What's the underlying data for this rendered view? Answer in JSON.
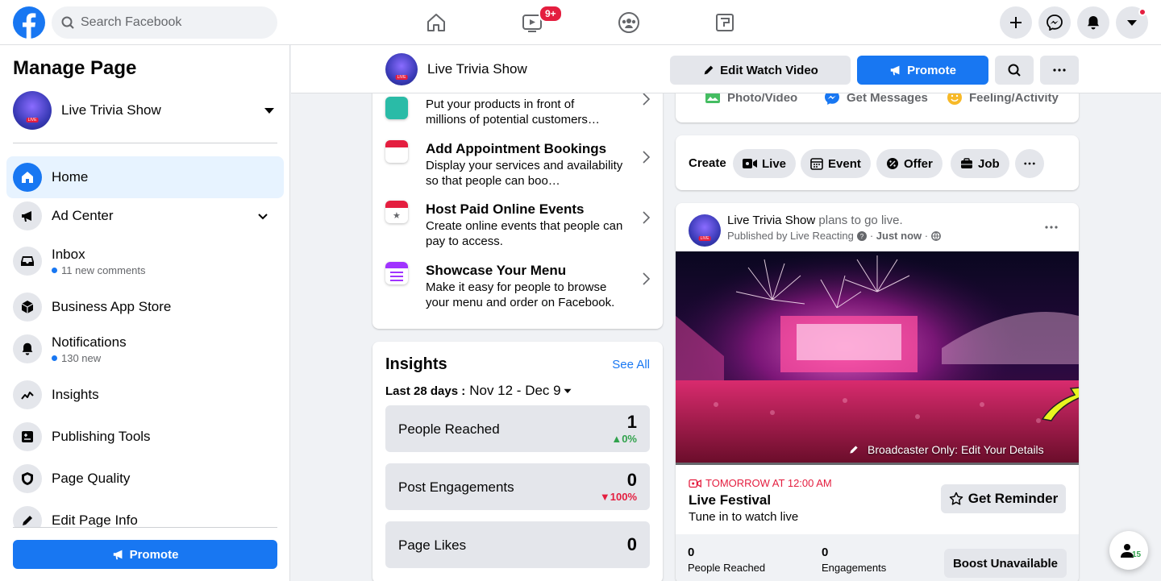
{
  "search": {
    "placeholder": "Search Facebook"
  },
  "topnav": {
    "watch_badge": "9+"
  },
  "sidebar": {
    "title": "Manage Page",
    "page_name": "Live Trivia Show",
    "items": [
      {
        "label": "Home"
      },
      {
        "label": "Ad Center"
      },
      {
        "label": "Inbox",
        "sub": "11 new comments"
      },
      {
        "label": "Business App Store"
      },
      {
        "label": "Notifications",
        "sub": "130 new"
      },
      {
        "label": "Insights"
      },
      {
        "label": "Publishing Tools"
      },
      {
        "label": "Page Quality"
      },
      {
        "label": "Edit Page Info"
      }
    ],
    "promote_label": "Promote"
  },
  "pagebar": {
    "name": "Live Trivia Show",
    "edit_watch_label": "Edit Watch Video",
    "promote_label": "Promote"
  },
  "tips": [
    {
      "title": "",
      "desc": "Put your products in front of millions of potential customers…"
    },
    {
      "title": "Add Appointment Bookings",
      "desc": "Display your services and availability so that people can boo…"
    },
    {
      "title": "Host Paid Online Events",
      "desc": "Create online events that people can pay to access."
    },
    {
      "title": "Showcase Your Menu",
      "desc": "Make it easy for people to browse your menu and order on Facebook."
    }
  ],
  "insights": {
    "title": "Insights",
    "see_all": "See All",
    "range_label": "Last 28 days :",
    "range_value": "Nov 12 - Dec 9",
    "rows": [
      {
        "label": "People Reached",
        "value": "1",
        "delta": "0%",
        "direction": "up"
      },
      {
        "label": "Post Engagements",
        "value": "0",
        "delta": "100%",
        "direction": "down"
      },
      {
        "label": "Page Likes",
        "value": "0",
        "delta": ""
      }
    ]
  },
  "composer": {
    "photo": "Photo/Video",
    "messages": "Get Messages",
    "feeling": "Feeling/Activity"
  },
  "create": {
    "label": "Create",
    "live": "Live",
    "event": "Event",
    "offer": "Offer",
    "job": "Job"
  },
  "post": {
    "author": "Live Trivia Show",
    "action": "plans to go live.",
    "published_by": "Published by Live Reacting",
    "time": "Just now",
    "overlay": "Broadcaster Only: Edit Your Details",
    "event_time": "TOMORROW AT 12:00 AM",
    "event_title": "Live Festival",
    "event_sub": "Tune in to watch live",
    "reminder_label": "Get Reminder",
    "stat1_value": "0",
    "stat1_label": "People Reached",
    "stat2_value": "0",
    "stat2_label": "Engagements",
    "boost_label": "Boost Unavailable"
  },
  "fab": {
    "count": "15"
  },
  "colors": {
    "brand": "#1877f2",
    "alert": "#e41e3f",
    "positive": "#31a24c"
  }
}
